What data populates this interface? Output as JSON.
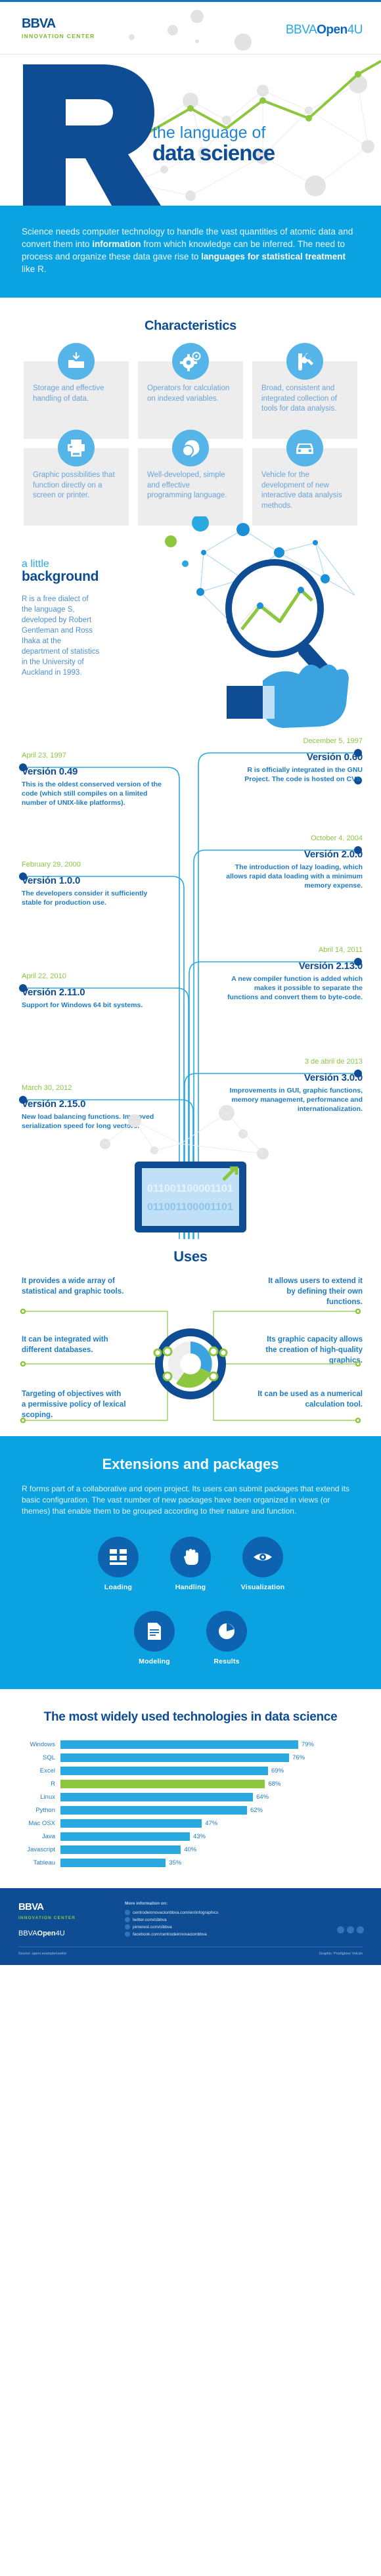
{
  "header": {
    "brand": "BBVA",
    "brand_sub": "INNOVATION CENTER",
    "open4u_a": "BBVA",
    "open4u_b": "Open",
    "open4u_c": "4U"
  },
  "hero": {
    "letter": "R",
    "subtitle_light": "the language of",
    "subtitle_bold": "data science"
  },
  "intro": {
    "t1": "Science needs computer technology to handle the vast quantities of atomic data and convert them into ",
    "b1": "information",
    "t2": " from which knowledge can be inferred. The need to process and organize these data gave rise to ",
    "b2": "languages for statistical treatment",
    "t3": " like R."
  },
  "characteristics": {
    "title": "Characteristics",
    "items": [
      {
        "icon": "folder-download-icon",
        "text": "Storage and effective handling of data."
      },
      {
        "icon": "gears-icon",
        "text": "Operators for calculation on indexed variables."
      },
      {
        "icon": "tools-icon",
        "text": "Broad, consistent and integrated collection of tools for data analysis."
      },
      {
        "icon": "printer-icon",
        "text": "Graphic possibilities that function directly on a screen or printer."
      },
      {
        "icon": "chat-bubbles-icon",
        "text": "Well-developed, simple and effective programming language."
      },
      {
        "icon": "car-icon",
        "text": "Vehicle for the development of new interactive data analysis methods."
      }
    ]
  },
  "background": {
    "kicker": "a little",
    "title": "background",
    "text": "R is a free dialect of the language S, developed by Robert Gentleman and Ross Ihaka at the department of statistics in the University of Auckland in 1993."
  },
  "timeline": [
    {
      "date": "April 23, 1997",
      "version": "Versión 0.49",
      "desc": "This is the oldest conserved version of the code (which still compiles on a limited number of UNIX-like platforms).",
      "side": "left"
    },
    {
      "date": "December 5, 1997",
      "version": "Versión 0.60",
      "desc": "R is officially integrated in the GNU Project. The code is hosted on CVS.",
      "side": "right"
    },
    {
      "date": "February 29, 2000",
      "version": "Versión 1.0.0",
      "desc": "The developers consider it sufficiently stable for production use.",
      "side": "left"
    },
    {
      "date": "October 4, 2004",
      "version": "Versión 2.0.0",
      "desc": "The introduction of lazy loading, which allows rapid data loading with a minimum memory expense.",
      "side": "right"
    },
    {
      "date": "April 22, 2010",
      "version": "Versión 2.11.0",
      "desc": "Support for Windows 64 bit systems.",
      "side": "left"
    },
    {
      "date": "Abril 14, 2011",
      "version": "Versión 2.13.0",
      "desc": "A new compiler function is added which makes it possible to separate the functions and convert them to byte-code.",
      "side": "right"
    },
    {
      "date": "March 30, 2012",
      "version": "Versión 2.15.0",
      "desc": "New load balancing functions. Improved serialization speed for long vectors.",
      "side": "left"
    },
    {
      "date": "3 de abril de 2013",
      "version": "Versión 3.0.0",
      "desc": "Improvements in GUI, graphic functions, memory management, performance and internationalization.",
      "side": "right"
    }
  ],
  "monitor": {
    "binary": "011001100001101"
  },
  "uses": {
    "title": "Uses",
    "items": [
      "It provides a wide array of statistical and graphic tools.",
      "It allows users to extend it by defining their own functions.",
      "It can be integrated with different databases.",
      "Its graphic capacity allows the creation of high-quality graphics.",
      "Targeting of objectives with a permissive policy of lexical scoping.",
      "It can be used as a numerical calculation tool."
    ]
  },
  "extensions": {
    "title": "Extensions and packages",
    "paragraph": "R forms part of a collaborative and open project. Its users can submit packages that extend its basic configuration. The vast number of new packages have been organized in views (or themes) that enable them to be grouped according to their nature and function.",
    "items": [
      {
        "icon": "loading-grid-icon",
        "label": "Loading"
      },
      {
        "icon": "hand-icon",
        "label": "Handling"
      },
      {
        "icon": "eye-icon",
        "label": "Visualization"
      },
      {
        "icon": "document-icon",
        "label": "Modeling"
      },
      {
        "icon": "pie-chart-icon",
        "label": "Results"
      }
    ]
  },
  "chart_data": {
    "type": "bar",
    "title": "The most widely used technologies in data science",
    "categories": [
      "Windows",
      "SQL",
      "Excel",
      "R",
      "Linux",
      "Python",
      "Mac OSX",
      "Java",
      "Javascript",
      "Tableau"
    ],
    "values": [
      79,
      76,
      69,
      68,
      64,
      62,
      47,
      43,
      40,
      35
    ],
    "labels": [
      "79%",
      "76%",
      "69%",
      "68%",
      "64%",
      "62%",
      "47%",
      "43%",
      "40%",
      "35%"
    ],
    "highlight_index": 3,
    "highlight_color": "#8dc63f",
    "bar_color": "#2aa8e0",
    "xlabel": "",
    "ylabel": "",
    "xlim": [
      0,
      100
    ],
    "grid": false,
    "legend": false,
    "orientation": "horizontal"
  },
  "footer": {
    "brand": "BBVA",
    "brand_sub": "INNOVATION CENTER",
    "open_a": "BBVA",
    "open_b": "Open",
    "open_c": "4U",
    "more_title": "More information on:",
    "links": [
      "centrodeinnovacionbbva.com/en/infographics",
      "twitter.com/cibbva",
      "pinterest.com/cibbva",
      "facebook.com/centrodeinnovacionbbva"
    ],
    "source": "Source: openr.example/useful",
    "credit": "Graphic: Prodigioso Volcán"
  }
}
